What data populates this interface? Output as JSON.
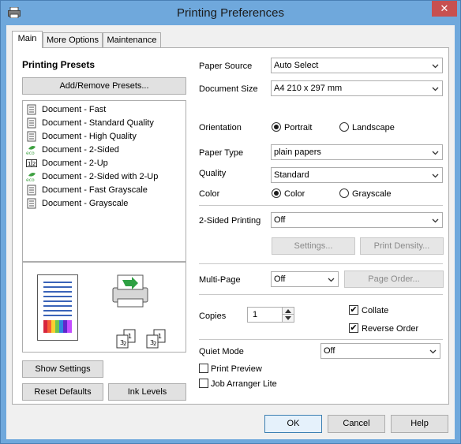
{
  "window": {
    "title": "Printing Preferences",
    "close_glyph": "✕"
  },
  "tabs": [
    {
      "label": "Main",
      "active": true
    },
    {
      "label": "More Options",
      "active": false
    },
    {
      "label": "Maintenance",
      "active": false
    }
  ],
  "presets": {
    "heading": "Printing Presets",
    "add_remove_label": "Add/Remove Presets...",
    "items": [
      {
        "label": "Document - Fast",
        "icon": "document-icon"
      },
      {
        "label": "Document - Standard Quality",
        "icon": "document-icon"
      },
      {
        "label": "Document - High Quality",
        "icon": "document-icon"
      },
      {
        "label": "Document - 2-Sided",
        "icon": "eco-icon"
      },
      {
        "label": "Document - 2-Up",
        "icon": "two-up-icon"
      },
      {
        "label": "Document - 2-Sided with 2-Up",
        "icon": "eco-icon"
      },
      {
        "label": "Document - Fast Grayscale",
        "icon": "document-icon"
      },
      {
        "label": "Document - Grayscale",
        "icon": "document-icon"
      }
    ]
  },
  "settings": {
    "paper_source": {
      "label": "Paper Source",
      "value": "Auto Select"
    },
    "document_size": {
      "label": "Document Size",
      "value": "A4 210 x 297 mm"
    },
    "orientation": {
      "label": "Orientation",
      "portrait": "Portrait",
      "landscape": "Landscape",
      "selected": "Portrait"
    },
    "paper_type": {
      "label": "Paper Type",
      "value": "plain papers"
    },
    "quality": {
      "label": "Quality",
      "value": "Standard"
    },
    "color": {
      "label": "Color",
      "color": "Color",
      "grayscale": "Grayscale",
      "selected": "Color"
    },
    "two_sided": {
      "label": "2-Sided Printing",
      "value": "Off",
      "settings_label": "Settings...",
      "density_label": "Print Density..."
    },
    "multi_page": {
      "label": "Multi-Page",
      "value": "Off",
      "page_order_label": "Page Order..."
    },
    "copies": {
      "label": "Copies",
      "value": "1",
      "collate": "Collate",
      "collate_checked": true,
      "reverse": "Reverse Order",
      "reverse_checked": true
    },
    "quiet_mode": {
      "label": "Quiet Mode",
      "value": "Off"
    },
    "print_preview": {
      "label": "Print Preview",
      "checked": false
    },
    "job_arranger": {
      "label": "Job Arranger Lite",
      "checked": false
    }
  },
  "left_buttons": {
    "show_settings": "Show Settings",
    "reset_defaults": "Reset Defaults",
    "ink_levels": "Ink Levels"
  },
  "footer": {
    "ok": "OK",
    "cancel": "Cancel",
    "help": "Help"
  },
  "colors": {
    "titlebar": "#6fa8dc",
    "close": "#c75050",
    "panel": "#f0f0f0"
  }
}
